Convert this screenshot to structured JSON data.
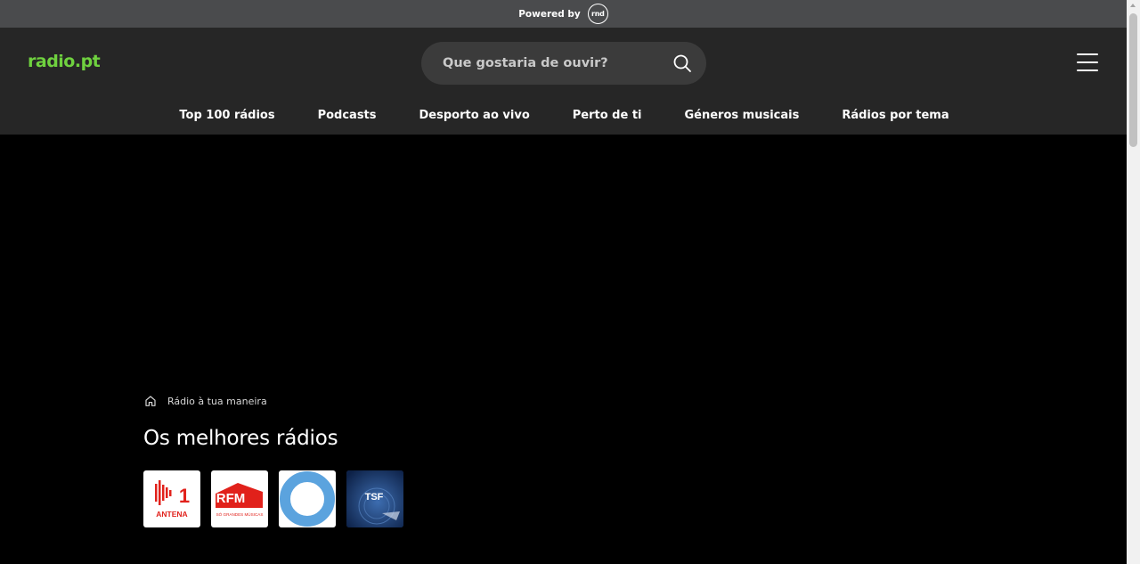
{
  "powered_by": {
    "label": "Powered by",
    "logo_text": "rnd"
  },
  "header": {
    "logo": "radio.pt",
    "search": {
      "placeholder": "Que gostaria de ouvir?",
      "value": ""
    },
    "menu_icon": "hamburger-menu-icon"
  },
  "nav": {
    "items": [
      {
        "label": "Top 100 rádios"
      },
      {
        "label": "Podcasts"
      },
      {
        "label": "Desporto ao vivo"
      },
      {
        "label": "Perto de ti"
      },
      {
        "label": "Géneros musicais"
      },
      {
        "label": "Rádios por tema"
      }
    ]
  },
  "breadcrumb": {
    "icon": "home-icon",
    "label": "Rádio à tua maneira"
  },
  "section": {
    "title": "Os melhores rádios"
  },
  "stations": [
    {
      "name": "Antena 1",
      "logo_text": "1",
      "logo_subtext": "ANTENA",
      "bg": "#ffffff",
      "accent": "#e1211b"
    },
    {
      "name": "RFM",
      "logo_text": "RFM",
      "logo_subtext": "SÓ GRANDES MÚSICAS",
      "bg": "#ffffff",
      "accent": "#e1211b"
    },
    {
      "name": "Rádio Comercial",
      "bg": "#ffffff",
      "accent": "#5ba3de"
    },
    {
      "name": "TSF",
      "logo_text": "TSF",
      "bg": "#1b3a6b",
      "accent": "#ffffff"
    }
  ],
  "colors": {
    "brand_green": "#6fd13f",
    "header_bg": "#262626",
    "top_bar_bg": "#4a4b4d",
    "page_bg": "#000000"
  }
}
